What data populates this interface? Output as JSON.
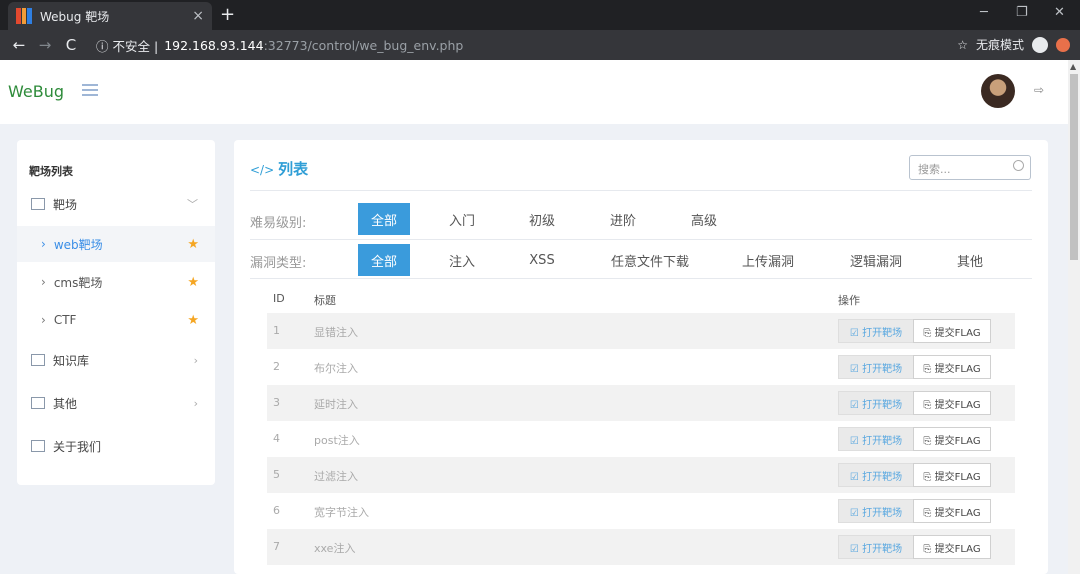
{
  "browser": {
    "tab_title": "Webug 靶场",
    "close": "×",
    "new_tab": "+",
    "back": "←",
    "forward": "→",
    "reload": "C",
    "security": "不安全",
    "url_host": "192.168.93.144",
    "url_path": ":32773/control/we_bug_env.php",
    "bookmark": "☆",
    "incognito": "无痕模式",
    "minimize": "─",
    "restore": "❐",
    "close_window": "✕"
  },
  "header": {
    "logo": "WeBug",
    "logout": "⇨"
  },
  "sidebar": {
    "title": "靶场列表",
    "range": {
      "label": "靶场",
      "chevron": "﹀"
    },
    "sub_items": [
      {
        "label": "web靶场",
        "star": "★"
      },
      {
        "label": "cms靶场",
        "star": "★"
      },
      {
        "label": "CTF",
        "star": "★"
      }
    ],
    "items": [
      {
        "label": "知识库",
        "chevron": "›"
      },
      {
        "label": "其他",
        "chevron": "›"
      },
      {
        "label": "关于我们",
        "chevron": ""
      }
    ]
  },
  "main": {
    "title_icon": "</>",
    "title": "列表",
    "search_placeholder": "搜索...",
    "difficulty": {
      "label": "难易级别:",
      "options": [
        "全部",
        "入门",
        "初级",
        "进阶",
        "高级"
      ],
      "selected": "全部"
    },
    "vuln_type": {
      "label": "漏洞类型:",
      "options": [
        "全部",
        "注入",
        "XSS",
        "任意文件下载",
        "上传漏洞",
        "逻辑漏洞",
        "其他"
      ],
      "selected": "全部"
    },
    "table": {
      "headers": {
        "id": "ID",
        "title": "标题",
        "action": "操作"
      },
      "open_label": "☑ 打开靶场",
      "flag_label": "⎘ 提交FLAG",
      "rows": [
        {
          "id": "1",
          "title": "显错注入"
        },
        {
          "id": "2",
          "title": "布尔注入"
        },
        {
          "id": "3",
          "title": "延时注入"
        },
        {
          "id": "4",
          "title": "post注入"
        },
        {
          "id": "5",
          "title": "过滤注入"
        },
        {
          "id": "6",
          "title": "宽字节注入"
        },
        {
          "id": "7",
          "title": "xxe注入"
        }
      ]
    }
  }
}
